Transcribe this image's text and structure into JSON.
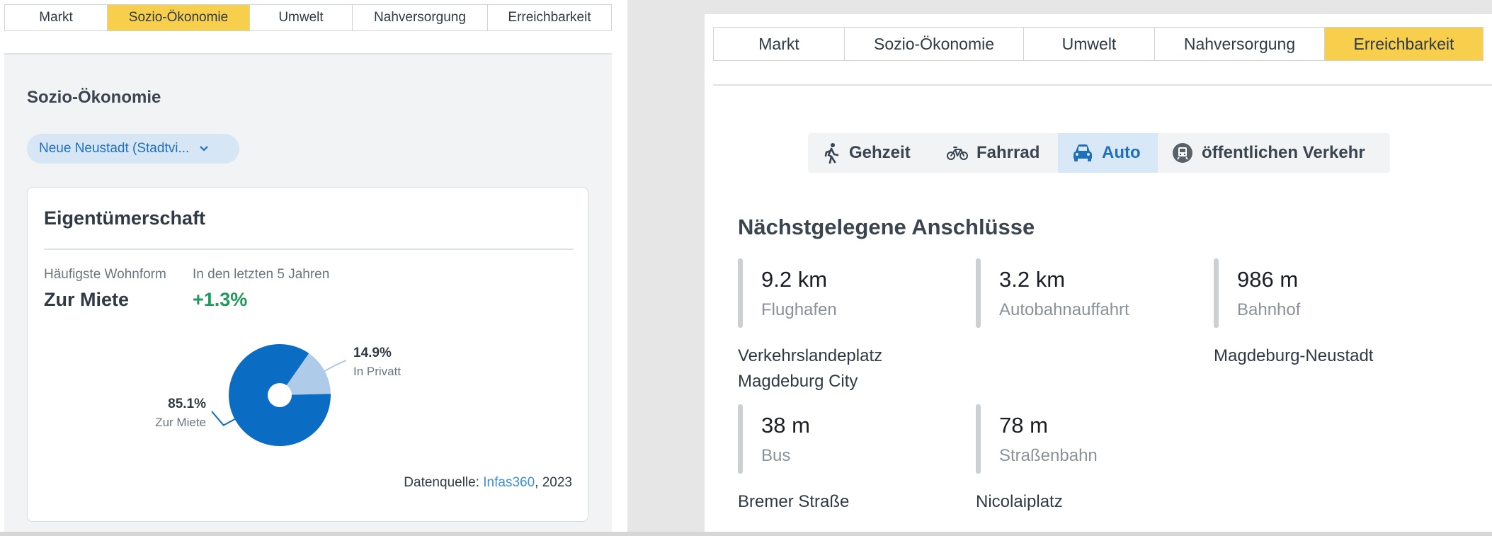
{
  "left": {
    "tabs": [
      {
        "label": "Markt",
        "active": false
      },
      {
        "label": "Sozio-Ökonomie",
        "active": true
      },
      {
        "label": "Umwelt",
        "active": false
      },
      {
        "label": "Nahversorgung",
        "active": false
      },
      {
        "label": "Erreichbarkeit",
        "active": false
      }
    ],
    "heading": "Sozio-Ökonomie",
    "region_select": {
      "value": "Neue Neustadt (Stadtvi...",
      "icon": "chevron-down-icon"
    },
    "card": {
      "title": "Eigentümerschaft",
      "kpi1": {
        "label": "Häufigste Wohnform",
        "value": "Zur Miete"
      },
      "kpi2": {
        "label": "In den letzten 5 Jahren",
        "value": "+1.3%"
      },
      "source_prefix": "Datenquelle: ",
      "source_link": "Infas360",
      "source_suffix": ", 2023"
    }
  },
  "chart_data": {
    "type": "pie",
    "donut": true,
    "slices": [
      {
        "label": "Zur Miete",
        "value": 85.1,
        "value_label": "85.1%",
        "color": "#0a6cc2"
      },
      {
        "label": "In Privatt",
        "value": 14.9,
        "value_label": "14.9%",
        "color": "#aecbea"
      }
    ]
  },
  "right": {
    "tabs": [
      {
        "label": "Markt",
        "active": false
      },
      {
        "label": "Sozio-Ökonomie",
        "active": false
      },
      {
        "label": "Umwelt",
        "active": false
      },
      {
        "label": "Nahversorgung",
        "active": false
      },
      {
        "label": "Erreichbarkeit",
        "active": true
      }
    ],
    "modes": [
      {
        "label": "Gehzeit",
        "icon": "walking-icon",
        "active": false
      },
      {
        "label": "Fahrrad",
        "icon": "bicycle-icon",
        "active": false
      },
      {
        "label": "Auto",
        "icon": "car-icon",
        "active": true
      },
      {
        "label": "öffentlichen Verkehr",
        "icon": "train-icon",
        "active": false
      }
    ],
    "section_title": "Nächstgelegene Anschlüsse",
    "connections": [
      {
        "distance": "9.2 km",
        "type": "Flughafen",
        "place": "Verkehrslandeplatz Magdeburg City"
      },
      {
        "distance": "3.2 km",
        "type": "Autobahnauffahrt",
        "place": ""
      },
      {
        "distance": "986 m",
        "type": "Bahnhof",
        "place": "Magdeburg-Neustadt"
      },
      {
        "distance": "38 m",
        "type": "Bus",
        "place": "Bremer Straße"
      },
      {
        "distance": "78 m",
        "type": "Straßenbahn",
        "place": "Nicolaiplatz"
      }
    ]
  },
  "colors": {
    "accent_tab": "#f8cf4c",
    "brand_blue": "#0a6cc2",
    "positive_green": "#1f9a5a",
    "link_blue": "#3a8fd6"
  }
}
